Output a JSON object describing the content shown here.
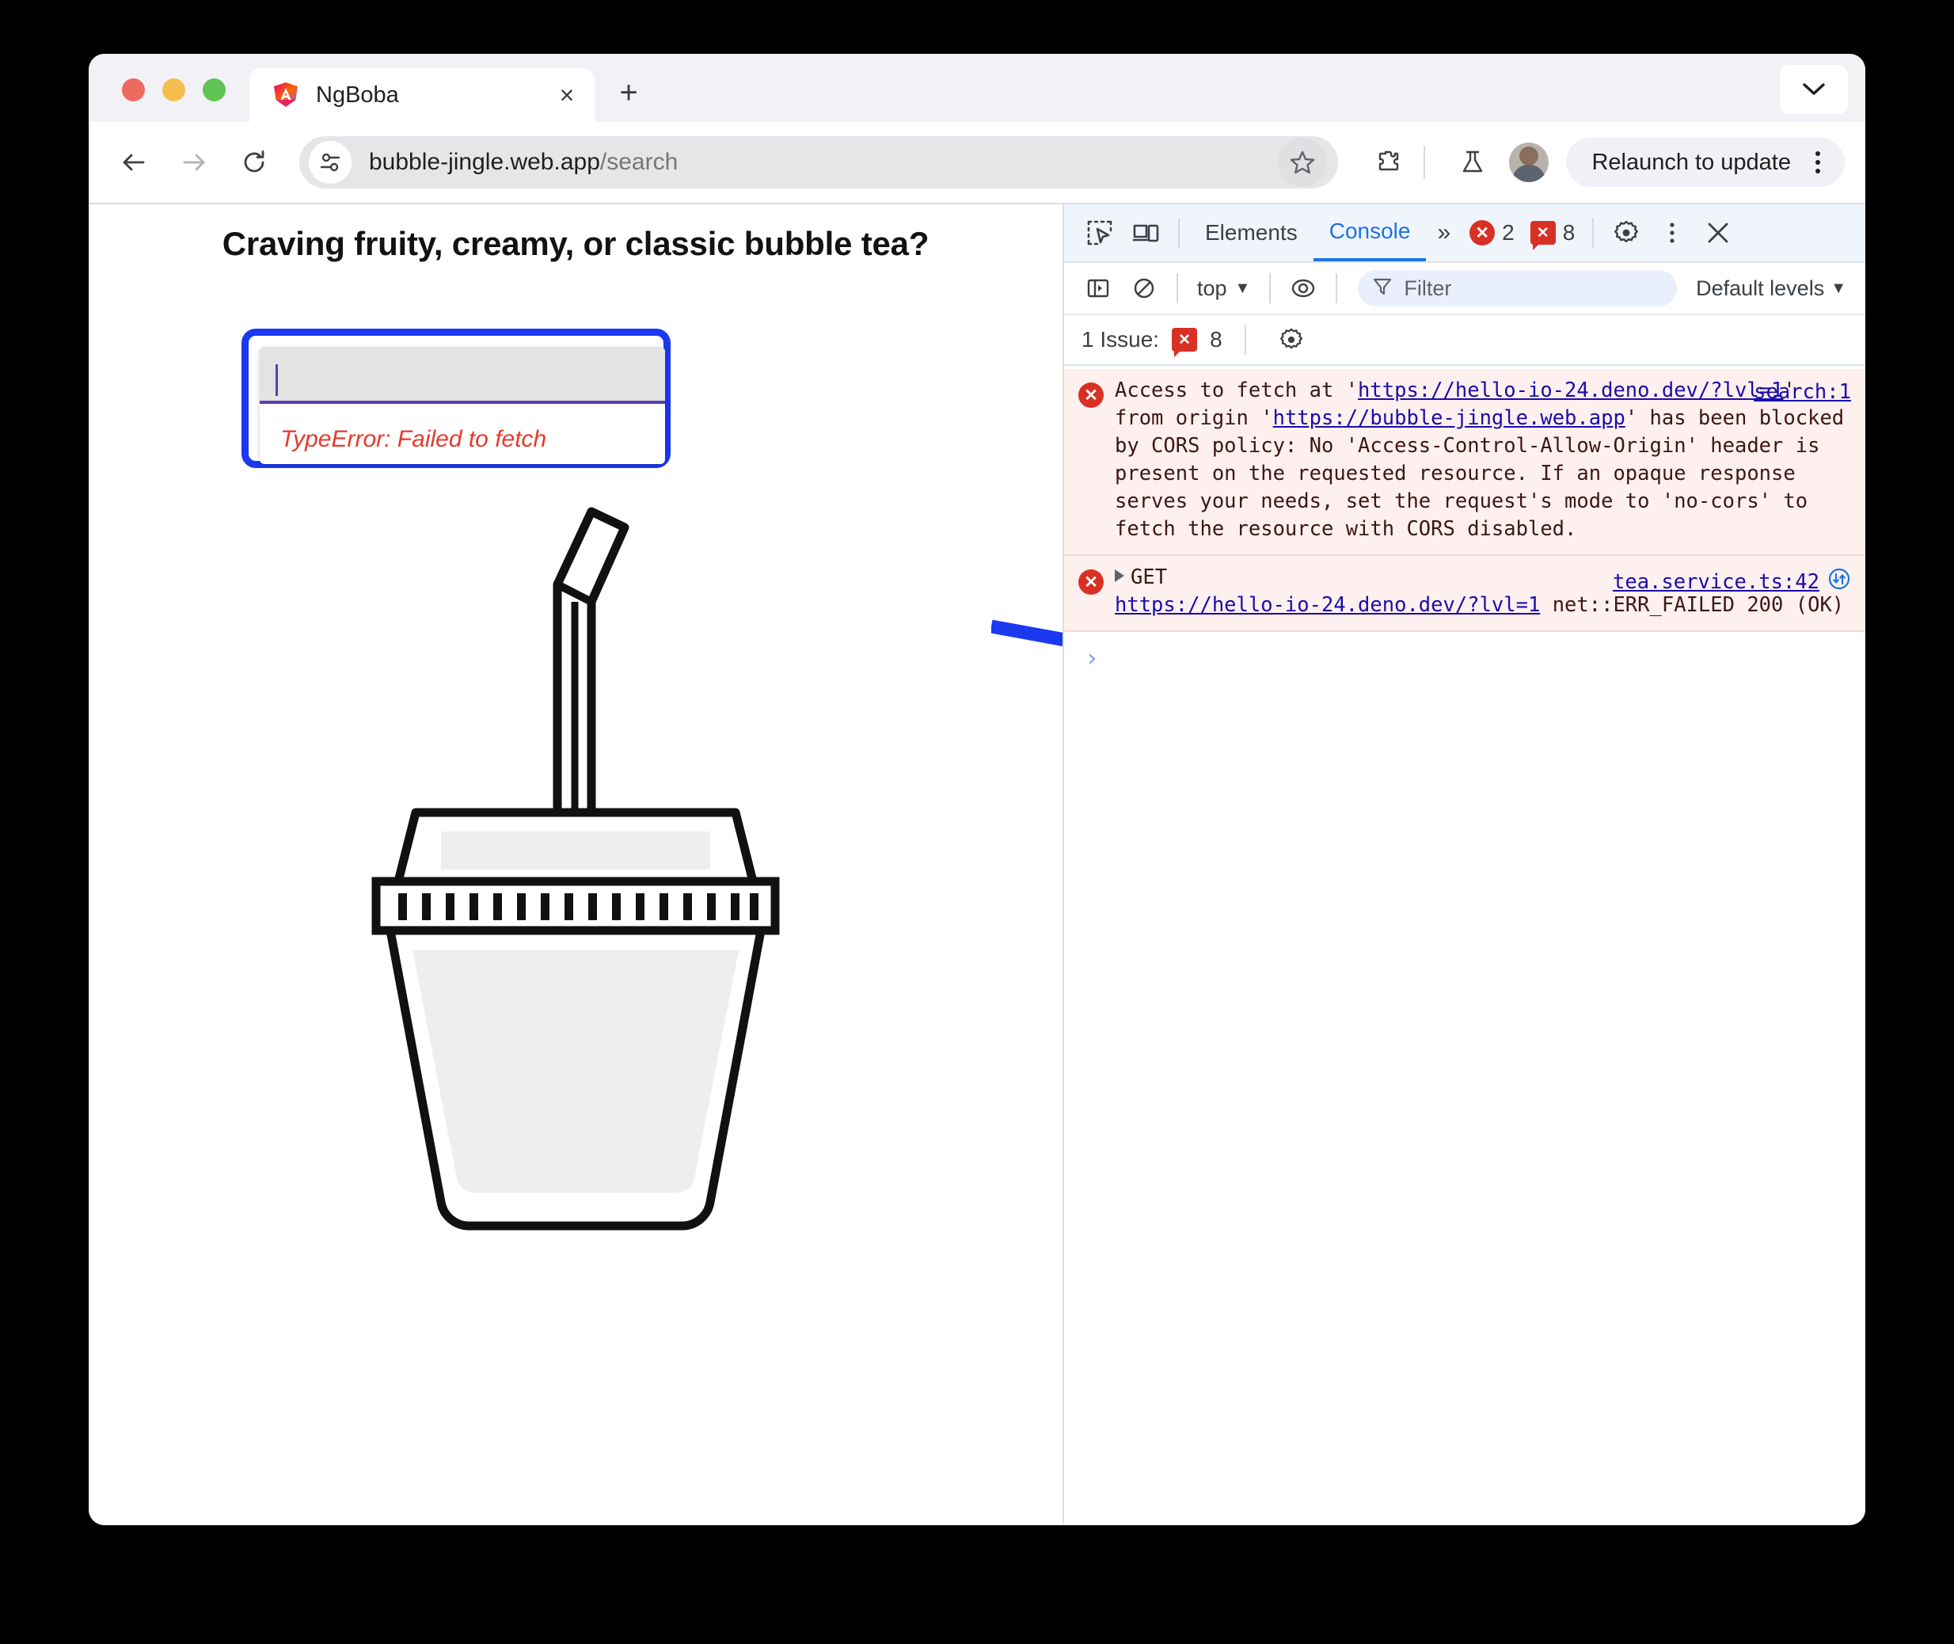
{
  "browser": {
    "tab": {
      "title": "NgBoba",
      "favicon": "angular-logo-icon",
      "close": "×"
    },
    "new_tab_label": "+",
    "tabstrip_chevron": "˅",
    "toolbar": {
      "back": "←",
      "forward": "→",
      "reload": "↻",
      "url_host": "bubble-jingle.web.app",
      "url_path": "/search",
      "site_info_icon": "tune-icon",
      "bookmark_icon": "star-icon",
      "extensions_icon": "puzzle-icon",
      "labs_icon": "flask-icon",
      "avatar_icon": "profile-avatar",
      "relaunch_label": "Relaunch to update",
      "menu_icon": "three-dot-menu"
    }
  },
  "page": {
    "heading": "Craving fruity, creamy, or classic bubble tea?",
    "search": {
      "value": "",
      "placeholder": "",
      "error": "TypeError: Failed to fetch"
    },
    "illustration": "bubble-tea-cup"
  },
  "devtools": {
    "tabbar": {
      "inspect_icon": "inspect-element-icon",
      "device_icon": "device-toolbar-icon",
      "tabs": [
        {
          "label": "Elements",
          "active": false
        },
        {
          "label": "Console",
          "active": true
        }
      ],
      "more_tabs": "»",
      "error_badge_count": "2",
      "issue_badge_count": "8",
      "settings_icon": "gear-icon",
      "more_icon": "three-dot-menu",
      "close_icon": "close-icon"
    },
    "filterbar": {
      "sidebar_icon": "console-sidebar-icon",
      "clear_icon": "clear-console-icon",
      "context": "top",
      "context_caret": "▼",
      "eye_icon": "live-expression-icon",
      "filter_icon": "filter-funnel-icon",
      "filter_placeholder": "Filter",
      "filter_value": "",
      "levels_label": "Default levels",
      "levels_caret": "▼"
    },
    "issuebar": {
      "label": "1 Issue:",
      "badge_count": "8",
      "settings_icon": "gear-icon"
    },
    "messages": [
      {
        "icon": "error-icon",
        "source": "search:1",
        "source_extra": "",
        "segments": [
          {
            "t": "Access to fetch at '",
            "link": false
          },
          {
            "t": "https://hello-io-24.deno.dev/?lvl=1",
            "link": true
          },
          {
            "t": "' from origin '",
            "link": false
          },
          {
            "t": "https://bubble-jingle.web.app",
            "link": true
          },
          {
            "t": "' has been blocked by CORS policy: No 'Access-Control-Allow-Origin' header is present on the requested resource. If an opaque response serves your needs, set the request's mode to 'no-cors' to fetch the resource with CORS disabled.",
            "link": false
          }
        ]
      },
      {
        "icon": "error-icon",
        "source": "tea.service.ts:42",
        "source_extra": "network-request-icon",
        "expandable": true,
        "segments": [
          {
            "t": "GET\n",
            "link": false
          },
          {
            "t": "https://hello-io-24.deno.dev/?lvl=1",
            "link": true
          },
          {
            "t": " net::ERR_FAILED 200 (OK)",
            "link": false
          }
        ]
      }
    ],
    "prompt_caret": "›"
  },
  "annotation": {
    "arrow_color": "#1a39f0",
    "highlight_color": "#1a39f0"
  },
  "colors": {
    "accent_blue": "#1a73e8",
    "error_red": "#d93025",
    "error_text": "#e8392b",
    "link_blue": "#1a0dab",
    "purple_underline": "#5b3fb0"
  }
}
